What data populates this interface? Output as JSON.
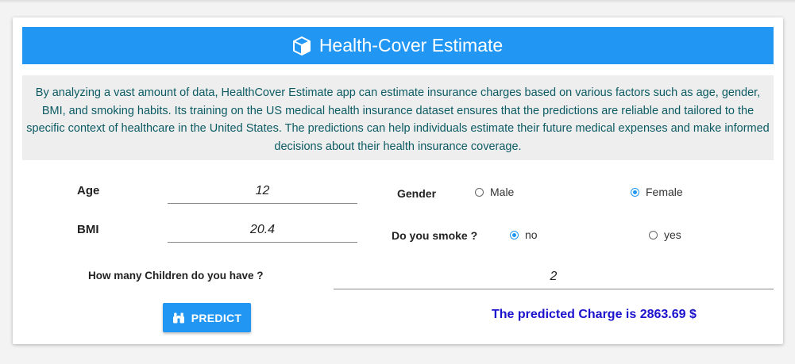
{
  "header": {
    "title": "Health-Cover Estimate",
    "icon": "cube-icon"
  },
  "description": "By analyzing a vast amount of data, HealthCover Estimate app can estimate insurance charges based on various factors such as age, gender, BMI, and smoking habits. Its training on the US medical health insurance dataset ensures that the predictions are reliable and tailored to the specific context of healthcare in the United States. The predictions can help individuals estimate their future medical expenses and make informed decisions about their health insurance coverage.",
  "form": {
    "age": {
      "label": "Age",
      "value": "12"
    },
    "bmi": {
      "label": "BMI",
      "value": "20.4"
    },
    "gender": {
      "label": "Gender",
      "options": [
        "Male",
        "Female"
      ],
      "selected": "Female"
    },
    "smoke": {
      "label": "Do you smoke ?",
      "options": [
        "no",
        "yes"
      ],
      "selected": "no"
    },
    "children": {
      "label": "How many Children do you have ?",
      "value": "2"
    }
  },
  "predict_button": {
    "label": "PREDICT",
    "icon": "binoculars-icon"
  },
  "result": "The predicted Charge is 2863.69 $",
  "colors": {
    "primary": "#2196f3",
    "description_text": "#0c5b63",
    "result_text": "#1a12cc"
  }
}
